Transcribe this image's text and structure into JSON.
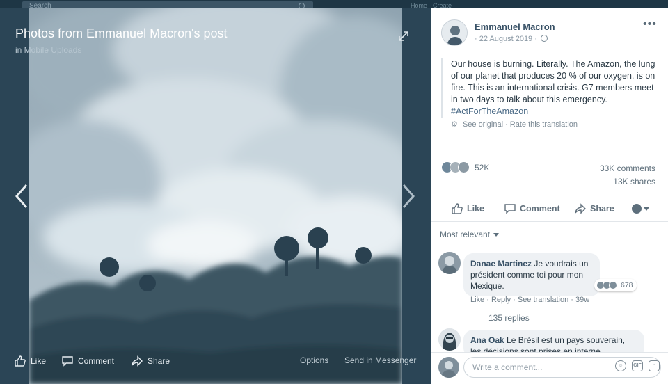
{
  "topbar": {
    "search_placeholder": "Search",
    "nav_text": "Home · Create"
  },
  "viewer": {
    "title": "Photos from Emmanuel Macron's post",
    "subtitle": "in Mobile Uploads",
    "actions": {
      "like": "Like",
      "comment": "Comment",
      "share": "Share",
      "options": "Options",
      "send": "Send in Messenger"
    }
  },
  "post": {
    "author": "Emmanuel Macron",
    "date": "· 22 August 2019 ·",
    "text": "Our house is burning. Literally. The Amazon, the lung of our planet that produces 20 % of our oxygen, is on fire. This is an international crisis. G7 members meet in two days to talk about this emergency.",
    "hashtag": "#ActForTheAmazon",
    "translation": "See original · Rate this translation",
    "reaction_count": "52K",
    "comments_count": "33K comments",
    "shares_count": "13K shares",
    "actions": {
      "like": "Like",
      "comment": "Comment",
      "share": "Share"
    }
  },
  "comments": {
    "sort_label": "Most relevant",
    "items": [
      {
        "name": "Danae Martinez",
        "text": "Je voudrais un président comme toi pour mon Mexique.",
        "reaction_count": "678",
        "meta": "Like · Reply · See translation · 39w",
        "replies": "135 replies"
      },
      {
        "name": "Ana Oak",
        "text": "Le Brésil est un pays souverain, les décisions sont prises en interne"
      }
    ],
    "composer_placeholder": "Write a comment...",
    "gif_label": "GIF"
  },
  "colors": {
    "accent": "#385166",
    "background": "#2f4a5c"
  }
}
